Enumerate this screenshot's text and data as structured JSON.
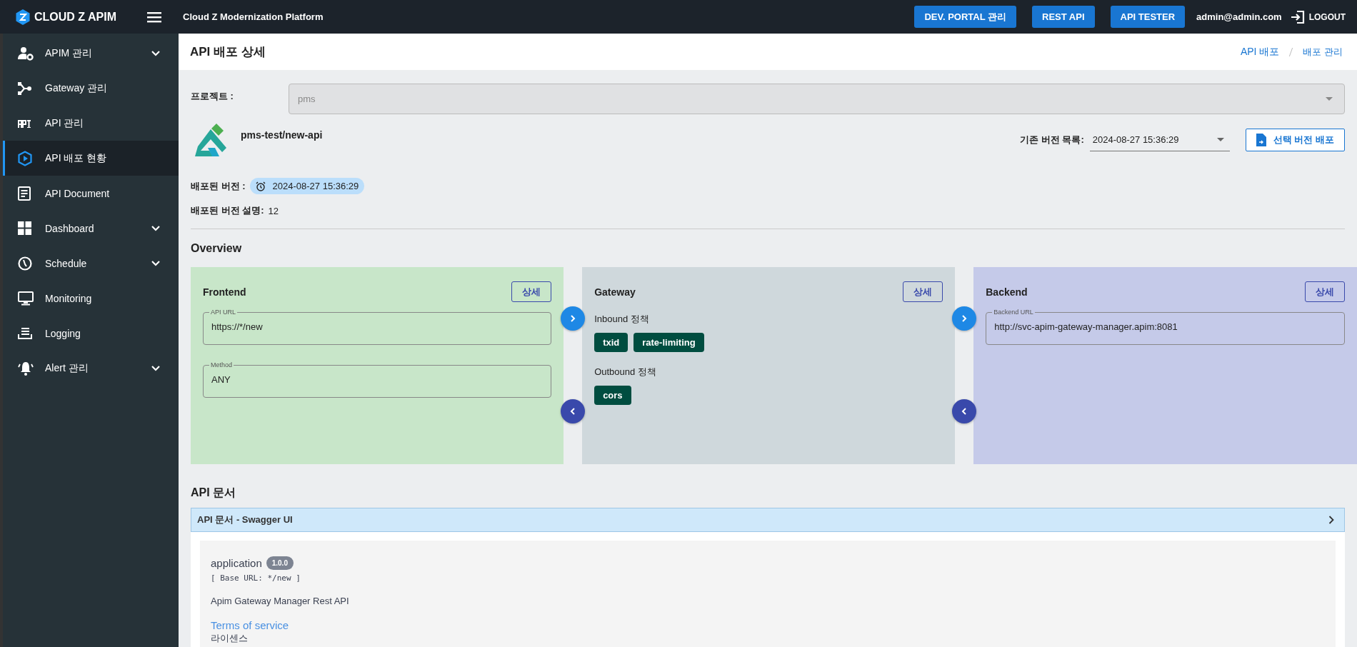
{
  "topbar": {
    "brand": "CLOUD Z APIM",
    "platform": "Cloud Z Modernization Platform",
    "buttons": [
      "DEV. PORTAL 관리",
      "REST API",
      "API TESTER"
    ],
    "user": "admin@admin.com",
    "logout": "LOGOUT"
  },
  "sidebar": {
    "items": [
      {
        "label": "APIM 관리",
        "submenu": true,
        "selected": false
      },
      {
        "label": "Gateway 관리",
        "submenu": false,
        "selected": false
      },
      {
        "label": "API 관리",
        "submenu": false,
        "selected": false
      },
      {
        "label": "API 배포 현황",
        "submenu": false,
        "selected": true
      },
      {
        "label": "API Document",
        "submenu": false,
        "selected": false
      },
      {
        "label": "Dashboard",
        "submenu": true,
        "selected": false
      },
      {
        "label": "Schedule",
        "submenu": true,
        "selected": false
      },
      {
        "label": "Monitoring",
        "submenu": false,
        "selected": false
      },
      {
        "label": "Logging",
        "submenu": false,
        "selected": false
      },
      {
        "label": "Alert 관리",
        "submenu": true,
        "selected": false
      }
    ]
  },
  "page": {
    "title": "API 배포 상세",
    "breadcrumb": [
      "API 배포",
      "배포 관리"
    ]
  },
  "project": {
    "label": "프로젝트 :",
    "value": "pms",
    "disabled": true
  },
  "api": {
    "name": "pms-test/new-api",
    "version_label": "기존 버전 목록:",
    "version_value": "2024-08-27 15:36:29",
    "deploy_button": "선택 버전 배포"
  },
  "deployed": {
    "version_label": "배포된 버전 :",
    "version": "2024-08-27 15:36:29",
    "desc_label": "배포된 버전 설명:",
    "desc": "12"
  },
  "overview": {
    "title": "Overview",
    "panels": [
      {
        "kind": "fields",
        "title": "Frontend",
        "button": "상세",
        "color": "#c8e6c9",
        "fields": [
          {
            "label": "API URL",
            "value": "https://*/new"
          },
          {
            "label": "Method",
            "value": "ANY"
          }
        ]
      },
      {
        "kind": "policies",
        "title": "Gateway",
        "button": "상세",
        "color": "#cfd8dc",
        "groups": [
          {
            "label": "Inbound 정책",
            "tags": [
              "txid",
              "rate-limiting"
            ]
          },
          {
            "label": "Outbound 정책",
            "tags": [
              "cors"
            ]
          }
        ]
      },
      {
        "kind": "fields",
        "title": "Backend",
        "button": "상세",
        "color": "#c5cae9",
        "fields": [
          {
            "label": "Backend URL",
            "value": "http://svc-apim-gateway-manager.apim:8081"
          }
        ]
      }
    ]
  },
  "docs": {
    "title": "API 문서",
    "accordion_title": "API 문서 - Swagger UI",
    "app_title": "application",
    "version": "1.0.0",
    "base_url": "[ Base URL: */new ]",
    "description": "Apim Gateway Manager Rest API",
    "terms_link": "Terms of service",
    "license": "라이센스"
  }
}
